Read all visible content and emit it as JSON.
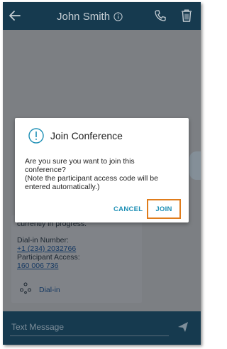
{
  "header": {
    "title": "John Smith",
    "back_icon": "back-arrow-icon",
    "info_icon": "info-icon",
    "phone_icon": "phone-icon",
    "trash_icon": "trash-icon"
  },
  "background_card": {
    "status_text": "currently in progress.",
    "dial_in_label": "Dial-in Number:",
    "dial_in_number": "+1 (234) 2032766",
    "participant_access_label": "Participant Access:",
    "participant_access_code": "160 006 736",
    "dial_in_link": "Dial-in"
  },
  "dialog": {
    "title": "Join Conference",
    "icon": "exclamation-circle-icon",
    "body_lines": [
      "Are you sure you want to join this",
      "conference?",
      "(Note the participant access code will be",
      "entered automatically.)"
    ],
    "cancel_label": "CANCEL",
    "join_label": "JOIN"
  },
  "composer": {
    "placeholder": "Text Message",
    "send_icon": "send-icon"
  },
  "colors": {
    "header_bg": "#163a4f",
    "overlay_bg": "#7c7f83",
    "accent": "#1d8fb5",
    "highlight": "#e07c1b"
  }
}
